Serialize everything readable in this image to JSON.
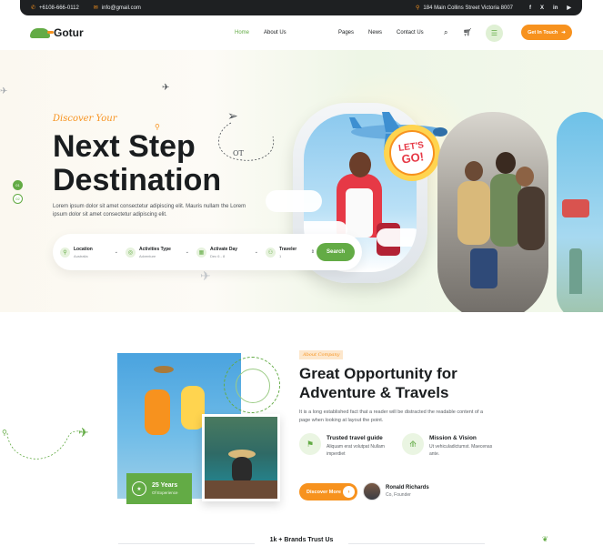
{
  "topbar": {
    "phone": "+6108-666-0112",
    "email": "info@gmail.com",
    "address": "184 Main Collins Street Victoria 8007",
    "social": [
      "f",
      "X",
      "in",
      "▶"
    ]
  },
  "header": {
    "logo": "Gotur",
    "nav": [
      "Home",
      "About Us",
      "Pages",
      "News",
      "Contact Us"
    ],
    "cta": "Get In Touch"
  },
  "hero": {
    "discover": "Discover Your",
    "title_line1": "Next Step",
    "title_line2": "Destination",
    "description": "Lorem ipsum dolor sit amet consectetur adipiscing elit. Mauris nullam the Lorem ipsum dolor sit amet consectetur adipiscing elit.",
    "slider_dots": [
      "01",
      "02"
    ],
    "badge_line1": "LET'S",
    "badge_line2": "GO!",
    "dashed_label": "OT"
  },
  "search": {
    "fields": [
      {
        "label": "Location",
        "value": "Australia",
        "icon": "map-pin-icon"
      },
      {
        "label": "Activities Type",
        "value": "Adventure",
        "icon": "compass-icon"
      },
      {
        "label": "Activate Day",
        "value": "Dec 6 - 8",
        "icon": "calendar-icon"
      },
      {
        "label": "Traveler",
        "value": "1",
        "icon": "users-icon"
      }
    ],
    "button": "Search"
  },
  "about": {
    "tag": "About Company",
    "title": "Great Opportunity for Adventure & Travels",
    "description": "It is a long established fact that a reader will be distracted the readable content of a page when looking at layout the point.",
    "experience_years": "25 Years",
    "experience_label": "Of Experience",
    "features": [
      {
        "title": "Trusted travel guide",
        "desc": "Aliquam erat volutpat Nullam imperdiet",
        "icon": "guide-icon"
      },
      {
        "title": "Mission & Vision",
        "desc": "Ut vehiculadictumst. Maecenas ante.",
        "icon": "mission-icon"
      }
    ],
    "button": "Discover More",
    "founder_name": "Ronald Richards",
    "founder_role": "Co, Founder"
  },
  "brands": {
    "heading": "1k + Brands Trust Us"
  },
  "colors": {
    "accent_green": "#63ab45",
    "accent_orange": "#f7921e",
    "dark": "#1e2022"
  }
}
